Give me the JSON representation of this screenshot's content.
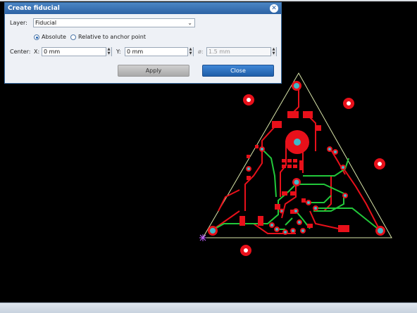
{
  "dialog": {
    "title": "Create fiducial",
    "layer_label": "Layer:",
    "layer_value": "Fiducial",
    "mode_absolute": "Absolute",
    "mode_relative": "Relative to anchor point",
    "center_label": "Center:",
    "x_label": "X:",
    "x_value": "0 mm",
    "y_label": "Y:",
    "y_value": "0 mm",
    "size_label": "ø:",
    "size_value": "1.5 mm",
    "apply_label": "Apply",
    "close_label": "Close",
    "selected_mode": "absolute"
  },
  "colors": {
    "background": "#000000",
    "copper": "#e8101a",
    "trace_green": "#22c83a",
    "board_outline": "#d8e4a8",
    "pad_center": "#40b8c8",
    "accent": "#2c62a4"
  }
}
